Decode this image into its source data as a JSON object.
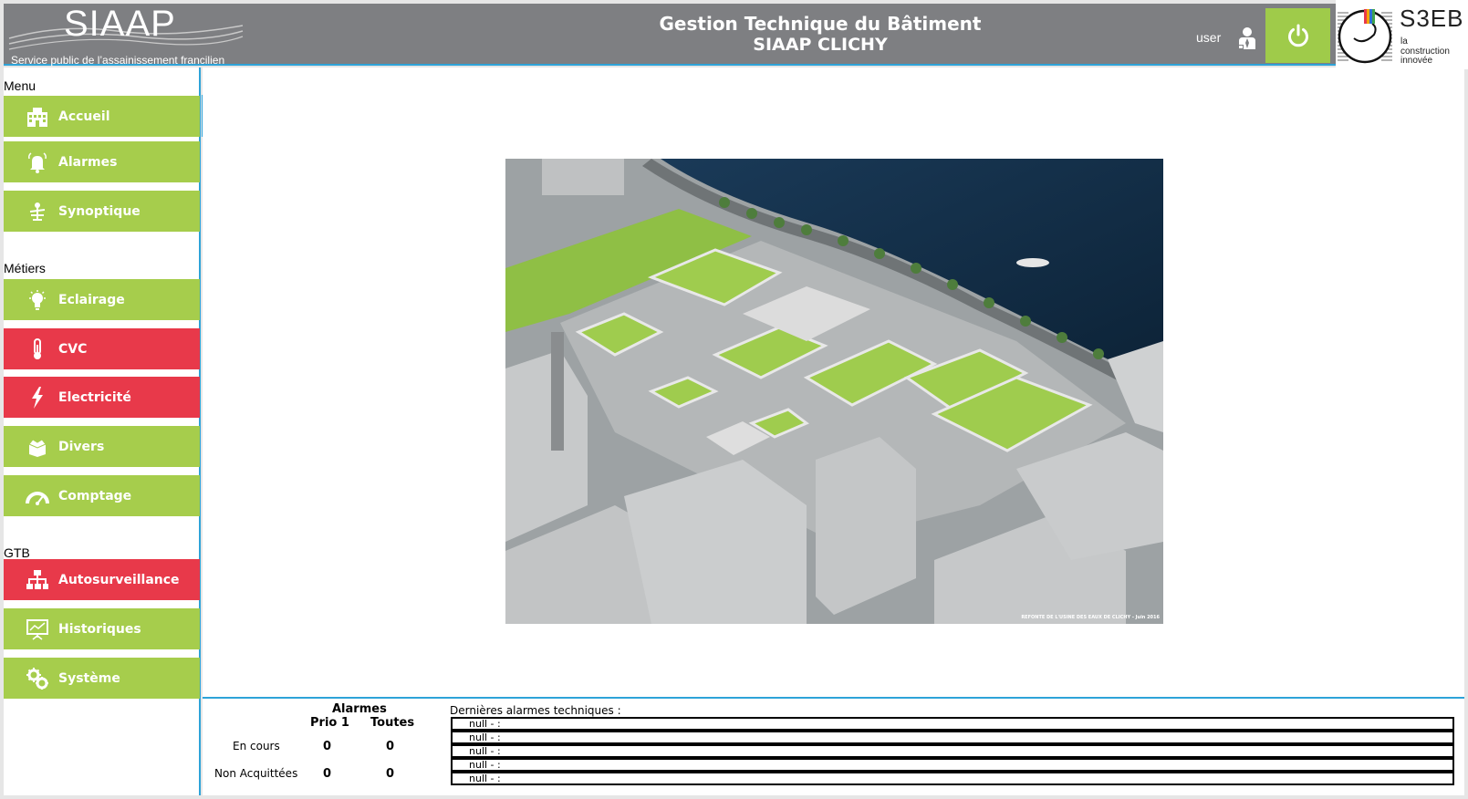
{
  "header": {
    "logo_word": "SIAAP",
    "logo_tagline": "Service public de l’assainissement francilien",
    "title_line1": "Gestion Technique du Bâtiment",
    "title_line2": "SIAAP CLICHY",
    "user_label": "user",
    "partner_logo": {
      "name": "S3EB",
      "line1": "la",
      "line2": "construction",
      "line3": "innovée"
    }
  },
  "sidebar": {
    "sections": [
      {
        "label": "Menu",
        "items": [
          {
            "label": "Accueil",
            "icon": "building-icon",
            "state": "ok"
          },
          {
            "label": "Alarmes",
            "icon": "bell-icon",
            "state": "ok"
          },
          {
            "label": "Synoptique",
            "icon": "synoptic-icon",
            "state": "ok"
          }
        ]
      },
      {
        "label": "Métiers",
        "items": [
          {
            "label": "Eclairage",
            "icon": "lightbulb-icon",
            "state": "ok"
          },
          {
            "label": "CVC",
            "icon": "thermometer-icon",
            "state": "alarm"
          },
          {
            "label": "Electricité",
            "icon": "lightning-icon",
            "state": "alarm"
          },
          {
            "label": "Divers",
            "icon": "box-icon",
            "state": "ok"
          },
          {
            "label": "Comptage",
            "icon": "gauge-icon",
            "state": "ok"
          }
        ]
      },
      {
        "label": "GTB",
        "items": [
          {
            "label": "Autosurveillance",
            "icon": "network-icon",
            "state": "alarm"
          },
          {
            "label": "Historiques",
            "icon": "chart-board-icon",
            "state": "ok"
          },
          {
            "label": "Système",
            "icon": "gears-icon",
            "state": "ok"
          }
        ]
      }
    ]
  },
  "main": {
    "image_caption": "REFONTE DE L'USINE DES EAUX DE CLICHY - Juin 2016"
  },
  "alarms": {
    "title": "Alarmes",
    "col_prio1": "Prio 1",
    "col_all": "Toutes",
    "row_current": {
      "label": "En cours",
      "prio1": "0",
      "all": "0"
    },
    "row_unack": {
      "label": "Non Acquittées",
      "prio1": "0",
      "all": "0"
    },
    "last_title": "Dernières alarmes techniques :",
    "last_items": [
      "null - :",
      "null - :",
      "null - :",
      "null - :",
      "null - :"
    ]
  },
  "colors": {
    "ok": "#a6cd4c",
    "alarm": "#e8394a",
    "header": "#7e7f82",
    "accent": "#2ea3d8"
  }
}
